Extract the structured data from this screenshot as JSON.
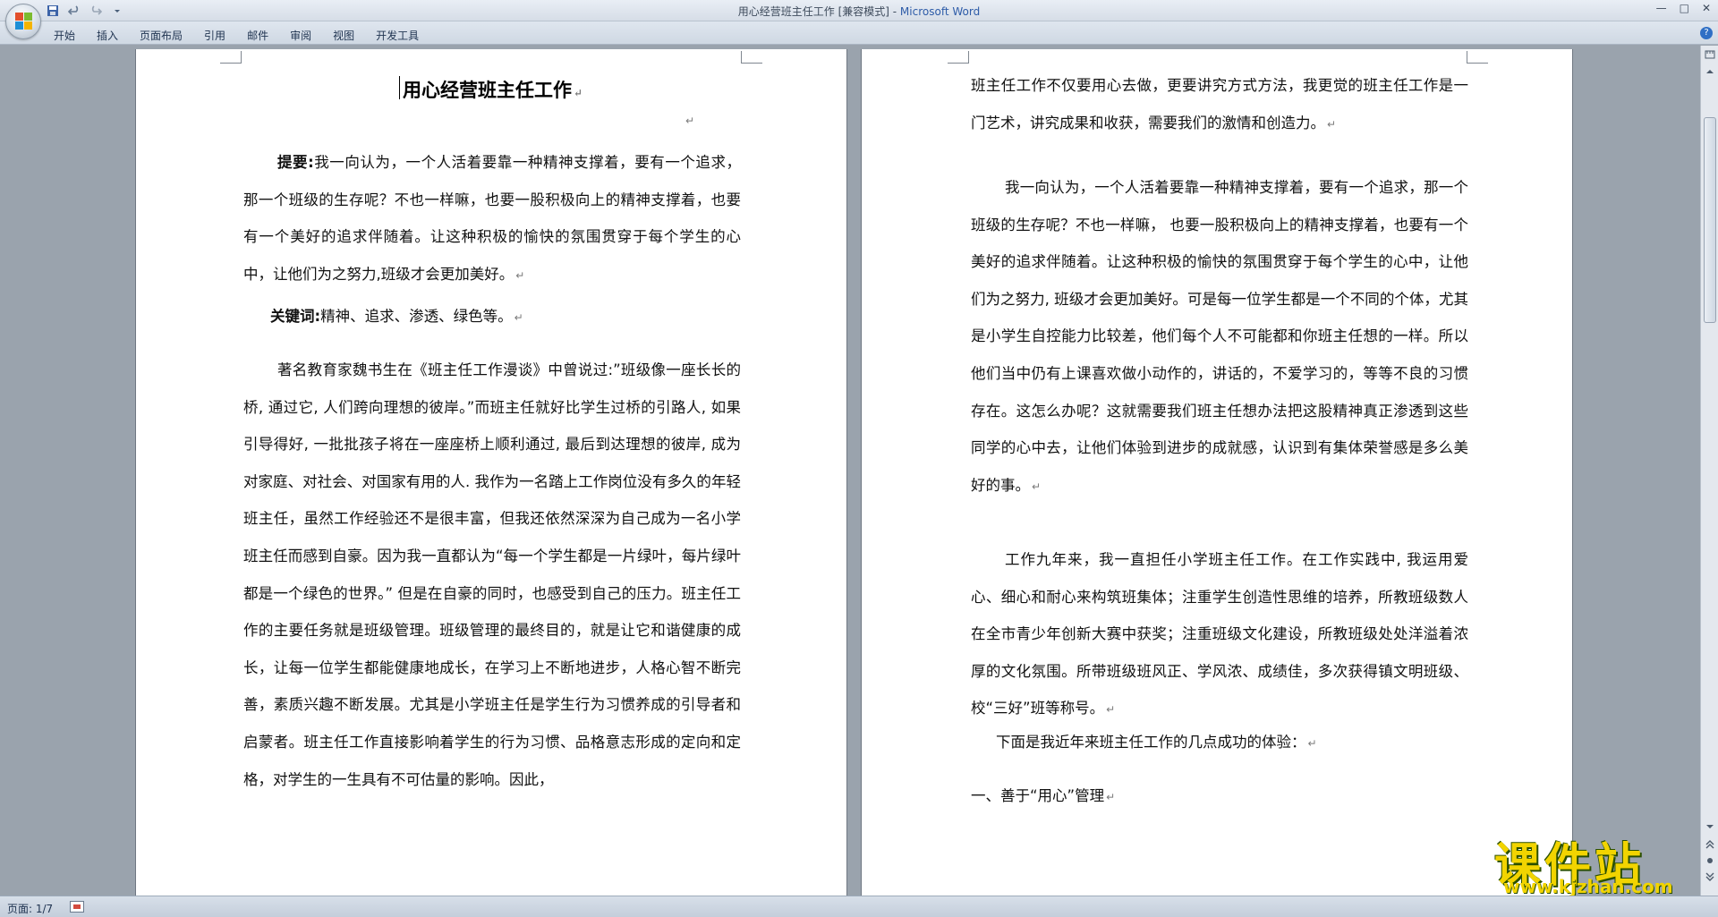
{
  "window": {
    "title": "用心经营班主任工作 [兼容模式] - ",
    "app_name": "Microsoft Word",
    "minimize": "—",
    "restore": "□",
    "close": "✕"
  },
  "quick_access": {
    "save_icon": "save-icon",
    "undo_icon": "undo-icon",
    "redo_icon": "redo-icon",
    "customize_icon": "customize-icon"
  },
  "ribbon": {
    "tabs": [
      "开始",
      "插入",
      "页面布局",
      "引用",
      "邮件",
      "审阅",
      "视图",
      "开发工具"
    ],
    "help": "?"
  },
  "document": {
    "title": "用心经营班主任工作",
    "left_page": {
      "abstract_label": "提要:",
      "abstract_text": "我一向认为，一个人活着要靠一种精神支撑着，要有一个追求，那一个班级的生存呢？不也一样嘛，也要一股积极向上的精神支撑着，也要有一个美好的追求伴随着。让这种积极的愉快的氛围贯穿于每个学生的心中，让他们为之努力,班级才会更加美好。",
      "keywords_label": "关键词:",
      "keywords_text": "精神、追求、渗透、绿色等。",
      "body_text": "著名教育家魏书生在《班主任工作漫谈》中曾说过:”班级像一座长长的桥, 通过它, 人们跨向理想的彼岸。”而班主任就好比学生过桥的引路人, 如果引导得好, 一批批孩子将在一座座桥上顺利通过, 最后到达理想的彼岸, 成为对家庭、对社会、对国家有用的人. 我作为一名踏上工作岗位没有多久的年轻班主任，虽然工作经验还不是很丰富，但我还依然深深为自己成为一名小学班主任而感到自豪。因为我一直都认为“每一个学生都是一片绿叶，每片绿叶都是一个绿色的世界。” 但是在自豪的同时，也感受到自己的压力。班主任工作的主要任务就是班级管理。班级管理的最终目的，就是让它和谐健康的成长，让每一位学生都能健康地成长，在学习上不断地进步，人格心智不断完善，素质兴趣不断发展。尤其是小学班主任是学生行为习惯养成的引导者和启蒙者。班主任工作直接影响着学生的行为习惯、品格意志形成的定向和定格，对学生的一生具有不可估量的影响。因此，"
    },
    "right_page": {
      "para1": "班主任工作不仅要用心去做，更要讲究方式方法，我更觉的班主任工作是一门艺术，讲究成果和收获，需要我们的激情和创造力。",
      "para2": "我一向认为，一个人活着要靠一种精神支撑着，要有一个追求，那一个班级的生存呢？不也一样嘛， 也要一股积极向上的精神支撑着，也要有一个美好的追求伴随着。让这种积极的愉快的氛围贯穿于每个学生的心中，让他们为之努力, 班级才会更加美好。可是每一位学生都是一个不同的个体，尤其是小学生自控能力比较差，他们每个人不可能都和你班主任想的一样。所以他们当中仍有上课喜欢做小动作的，讲话的，不爱学习的，等等不良的习惯存在。这怎么办呢？这就需要我们班主任想办法把这股精神真正渗透到这些同学的心中去，让他们体验到进步的成就感，认识到有集体荣誉感是多么美好的事。",
      "para3": "工作九年来，我一直担任小学班主任工作。在工作实践中, 我运用爱心、细心和耐心来构筑班集体；注重学生创造性思维的培养，所教班级数人在全市青少年创新大赛中获奖；注重班级文化建设，所教班级处处洋溢着浓厚的文化氛围。所带班级班风正、学风浓、成绩佳，多次获得镇文明班级、校“三好”班等称号。",
      "para4": "下面是我近年来班主任工作的几点成功的体验：",
      "heading1": "一、善于“用心”管理"
    },
    "paragraph_mark": "↵"
  },
  "status": {
    "page": "页面: 1/7"
  },
  "watermark": {
    "main": "课件站",
    "url": "www.kjzhan.com"
  },
  "colors": {
    "app_name": "#2e5ca8",
    "watermark": "#f2d400"
  }
}
